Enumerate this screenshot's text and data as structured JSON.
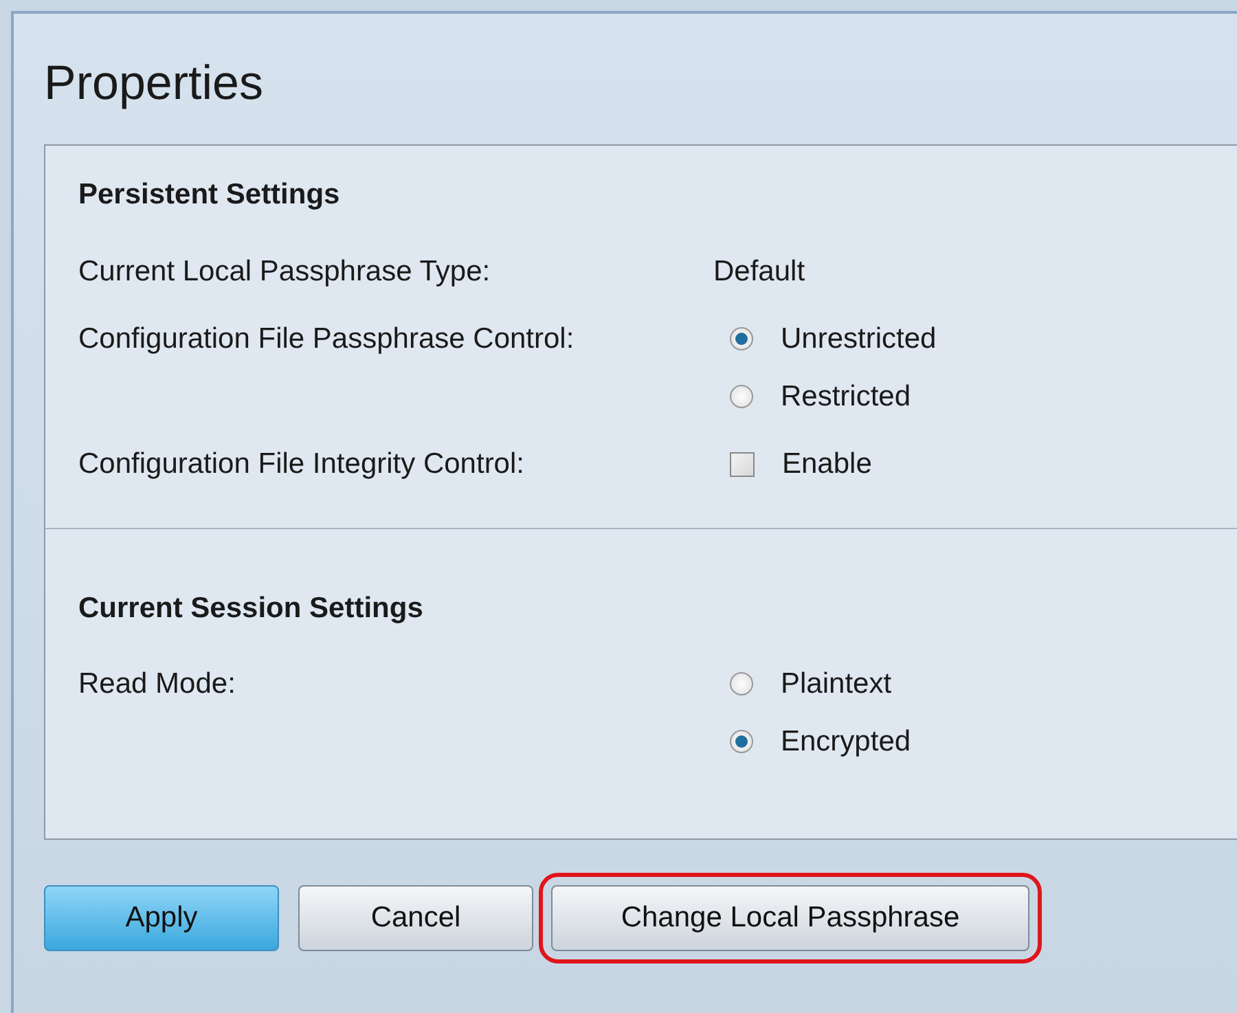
{
  "title": "Properties",
  "sections": [
    {
      "heading": "Persistent Settings",
      "fields": [
        {
          "label": "Current Local Passphrase Type:",
          "kind": "text",
          "value": "Default"
        },
        {
          "label": "Configuration File Passphrase Control:",
          "kind": "radio",
          "options": [
            {
              "label": "Unrestricted",
              "selected": true
            },
            {
              "label": "Restricted",
              "selected": false
            }
          ]
        },
        {
          "label": "Configuration File Integrity Control:",
          "kind": "checkbox",
          "option": "Enable",
          "checked": false
        }
      ]
    },
    {
      "heading": "Current Session Settings",
      "fields": [
        {
          "label": "Read Mode:",
          "kind": "radio",
          "options": [
            {
              "label": "Plaintext",
              "selected": false
            },
            {
              "label": "Encrypted",
              "selected": true
            }
          ]
        }
      ]
    }
  ],
  "buttons": [
    {
      "label": "Apply",
      "primary": true,
      "highlighted": false
    },
    {
      "label": "Cancel",
      "primary": false,
      "highlighted": false
    },
    {
      "label": "Change Local Passphrase",
      "primary": false,
      "highlighted": true
    }
  ]
}
